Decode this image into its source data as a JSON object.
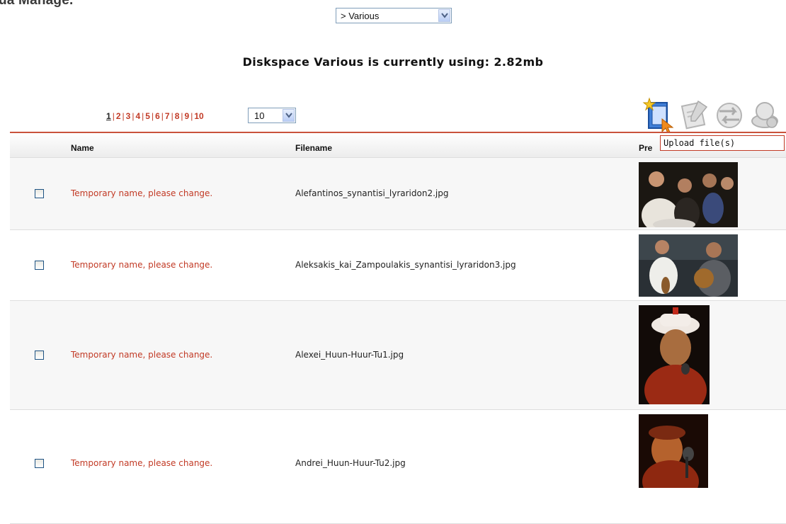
{
  "page": {
    "title": "ua Manage."
  },
  "folder_select": {
    "value": "> Various"
  },
  "diskspace": {
    "text": "Diskspace Various is currently using: 2.82mb"
  },
  "pager": {
    "pages": [
      "1",
      "2",
      "3",
      "4",
      "5",
      "6",
      "7",
      "8",
      "9",
      "10"
    ],
    "current": "1",
    "per_page": "10"
  },
  "toolbar": {
    "icons": [
      "upload-files-icon",
      "edit-icon",
      "move-icon",
      "delete-icon"
    ],
    "tooltip": "Upload file(s)"
  },
  "table": {
    "columns": {
      "name": "Name",
      "filename": "Filename",
      "preview": "Pre"
    },
    "rows": [
      {
        "name": "Temporary name, please change.",
        "filename": "Alefantinos_synantisi_lyraridon2.jpg"
      },
      {
        "name": "Temporary name, please change.",
        "filename": "Aleksakis_kai_Zampoulakis_synantisi_lyraridon3.jpg"
      },
      {
        "name": "Temporary name, please change.",
        "filename": "Alexei_Huun-Huur-Tu1.jpg"
      },
      {
        "name": "Temporary name, please change.",
        "filename": "Andrei_Huun-Huur-Tu2.jpg"
      }
    ]
  },
  "colors": {
    "accent": "#c23a25",
    "border": "#7f9db9"
  }
}
